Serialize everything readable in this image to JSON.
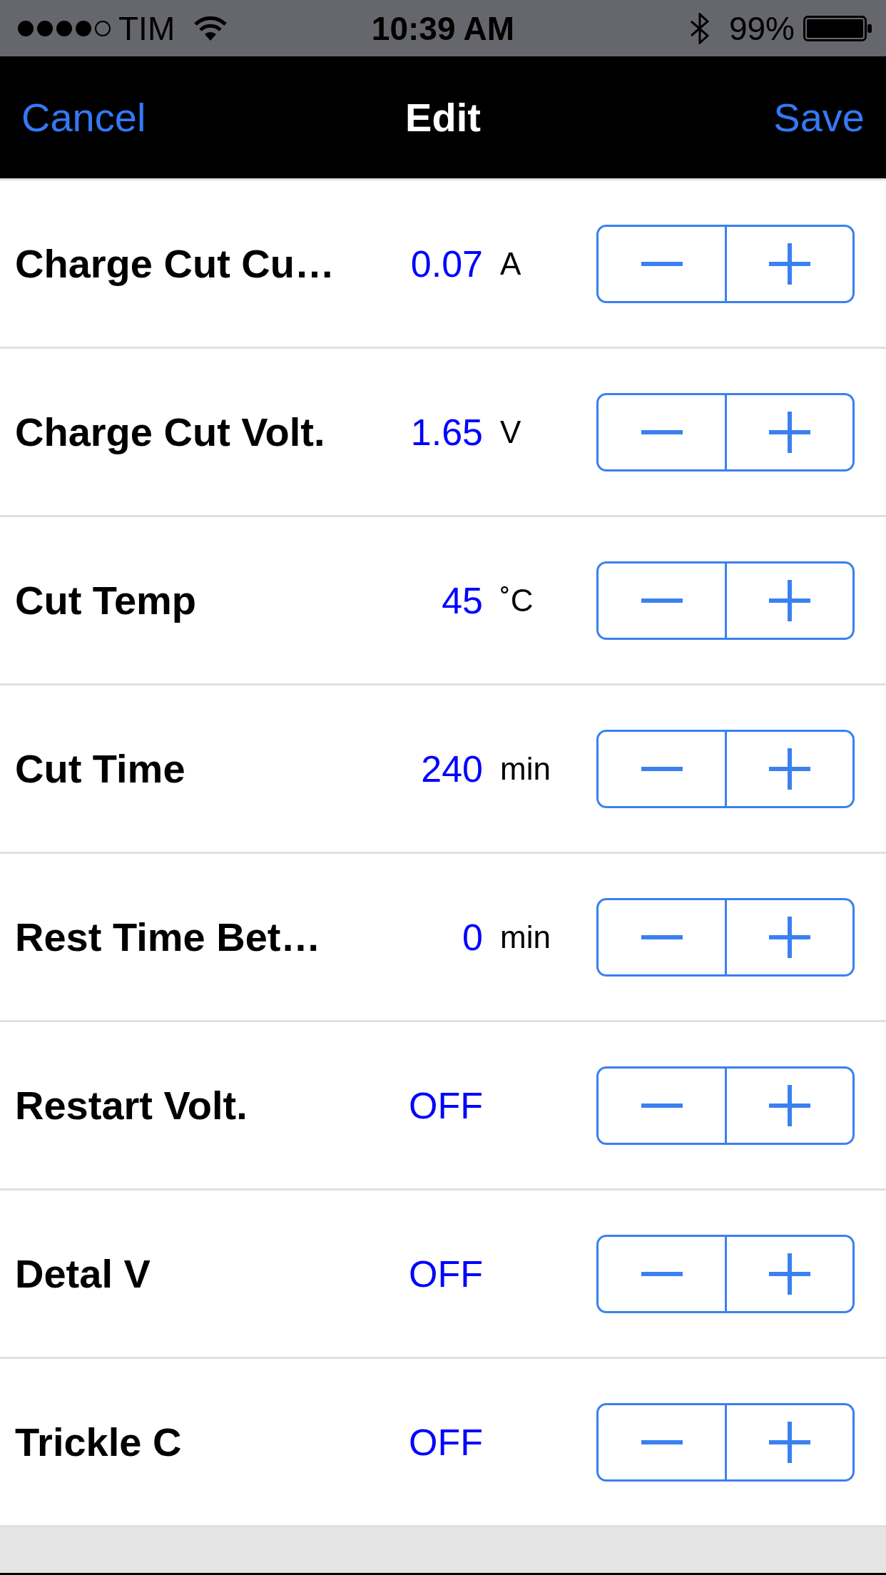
{
  "status_bar": {
    "carrier": "TIM",
    "time": "10:39 AM",
    "battery": "99%"
  },
  "nav_bar": {
    "cancel": "Cancel",
    "title": "Edit",
    "save": "Save"
  },
  "settings": [
    {
      "label": "Charge Cut Cu…",
      "value": "0.07",
      "unit": "A"
    },
    {
      "label": "Charge Cut Volt.",
      "value": "1.65",
      "unit": "V"
    },
    {
      "label": "Cut Temp",
      "value": "45",
      "unit": "˚C"
    },
    {
      "label": "Cut Time",
      "value": "240",
      "unit": "min"
    },
    {
      "label": "Rest Time Bet…",
      "value": "0",
      "unit": "min"
    },
    {
      "label": "Restart Volt.",
      "value": "OFF"
    },
    {
      "label": "Detal V",
      "value": "OFF"
    },
    {
      "label": "Trickle C",
      "value": "OFF"
    }
  ]
}
